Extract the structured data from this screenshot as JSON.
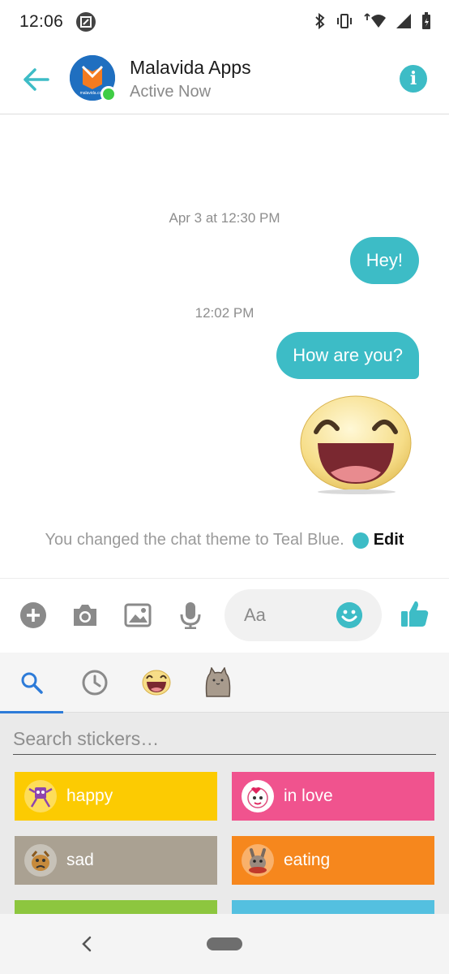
{
  "status_bar": {
    "time": "12:06"
  },
  "header": {
    "contact_name": "Malavida Apps",
    "contact_status": "Active Now",
    "avatar_text": "malavida.com"
  },
  "messages": {
    "timestamp_1": "Apr 3 at 12:30 PM",
    "bubble_1": "Hey!",
    "timestamp_2": "12:02 PM",
    "bubble_2": "How are you?",
    "theme_notice": "You changed the chat theme to Teal Blue.",
    "theme_edit": "Edit"
  },
  "composer": {
    "placeholder": "Aa"
  },
  "sticker_panel": {
    "search_placeholder": "Search stickers…",
    "categories": [
      {
        "label": "happy",
        "color": "#fccb02"
      },
      {
        "label": "in love",
        "color": "#f0538e"
      },
      {
        "label": "sad",
        "color": "#aaa192"
      },
      {
        "label": "eating",
        "color": "#f6871d"
      }
    ]
  },
  "colors": {
    "accent": "#3dbcc6",
    "tab_indicator": "#2d7bd8"
  }
}
